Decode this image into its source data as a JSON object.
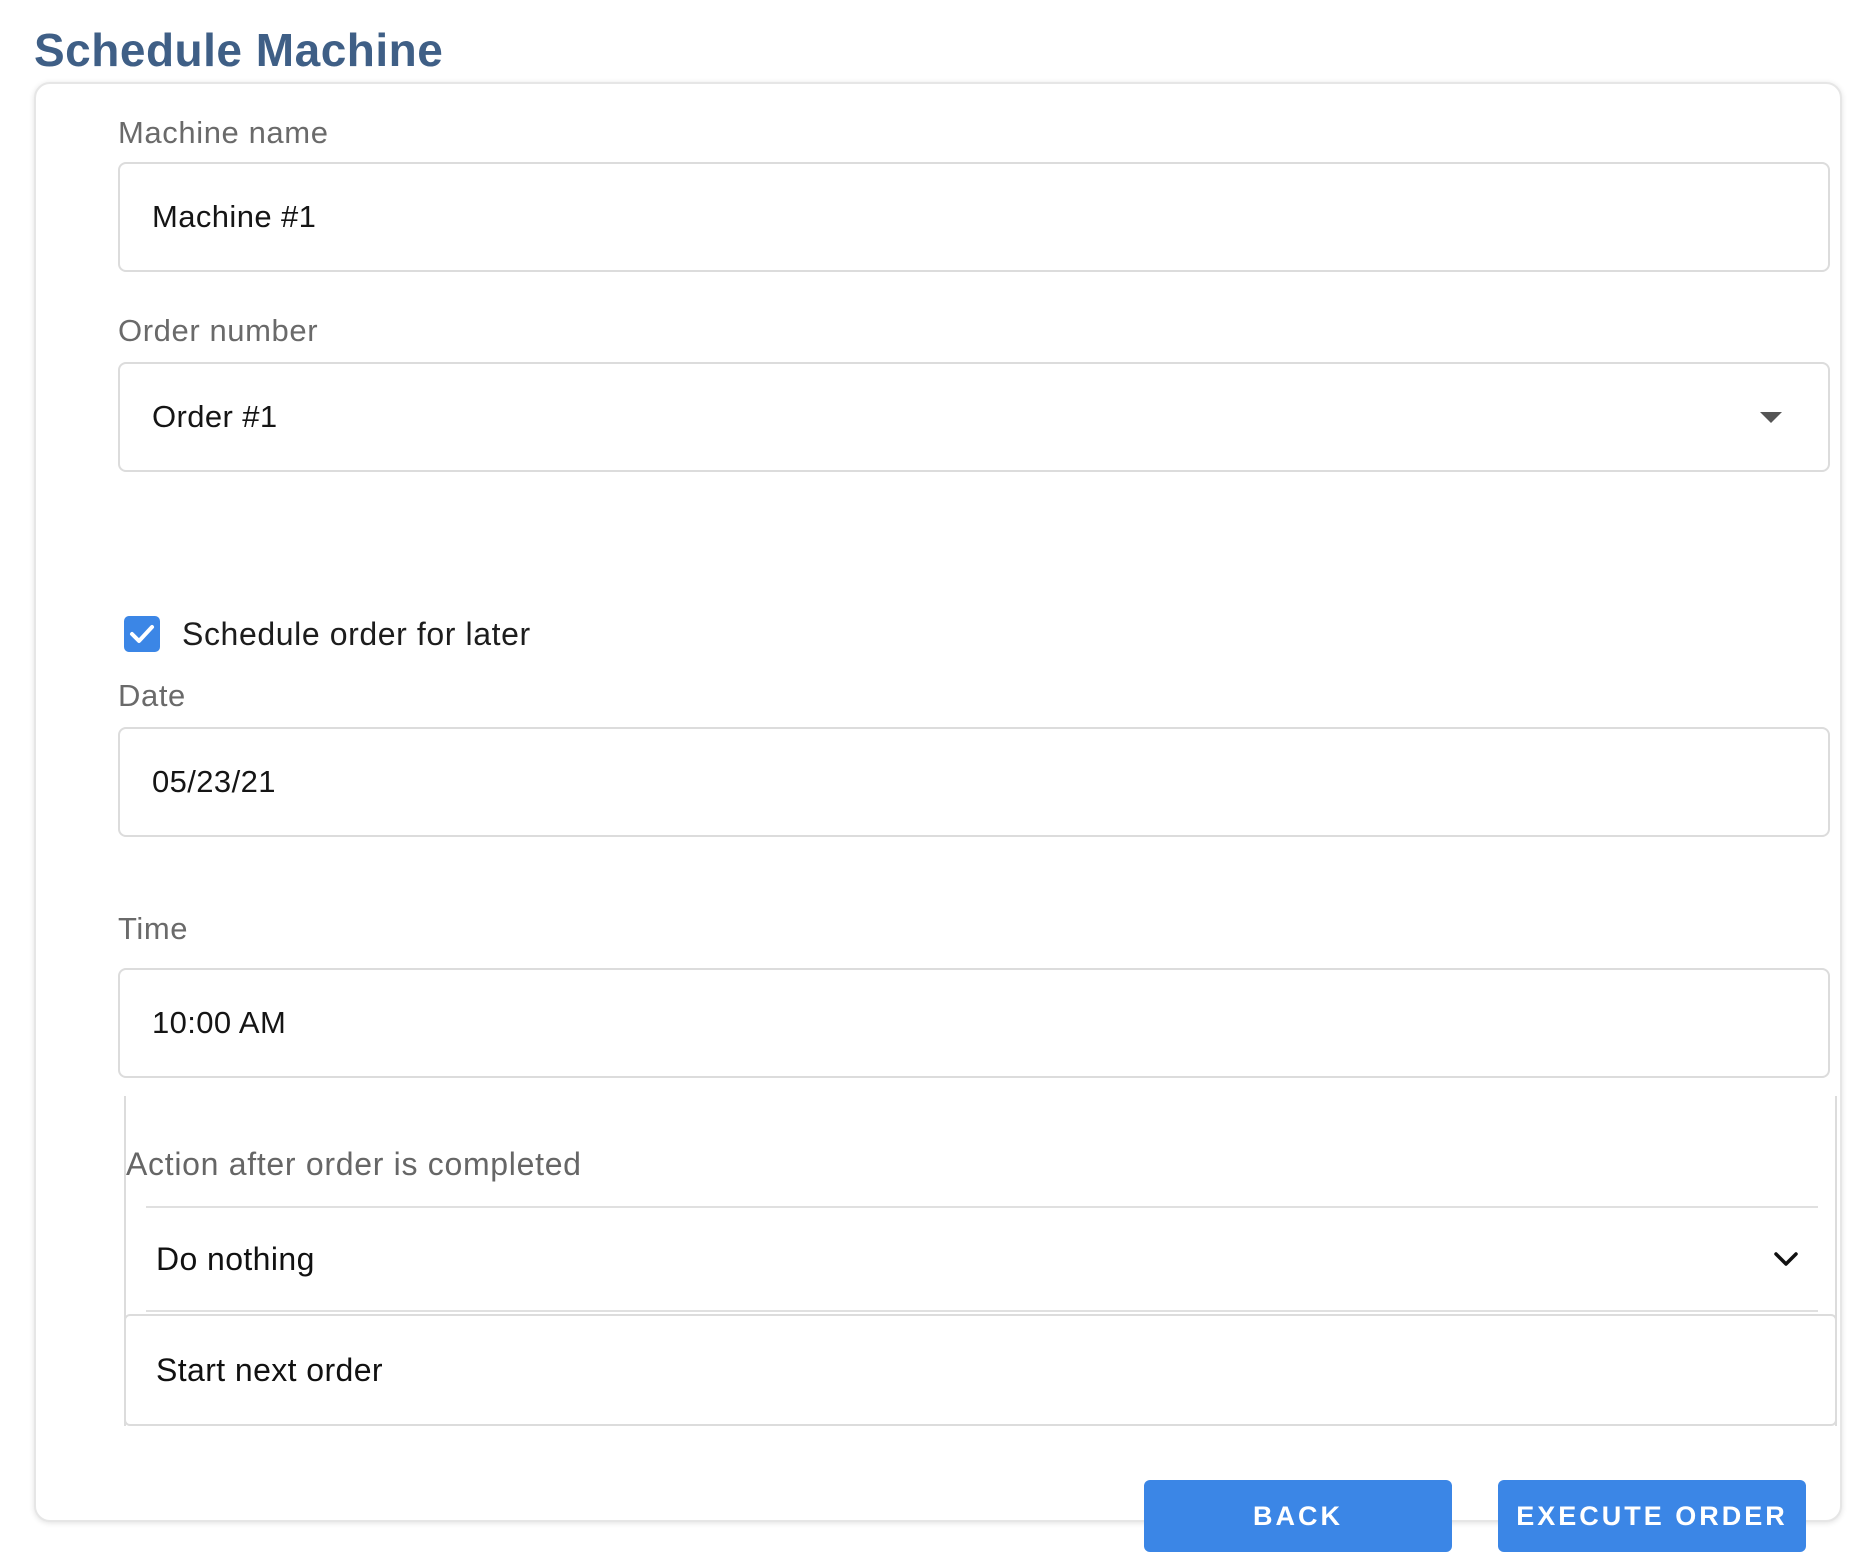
{
  "page": {
    "title": "Schedule Machine"
  },
  "form": {
    "machine_name": {
      "label": "Machine name",
      "value": "Machine #1"
    },
    "order_number": {
      "label": "Order number",
      "value": "Order #1",
      "icon": "caret-down-icon"
    },
    "schedule_later": {
      "label": "Schedule order for later",
      "checked": true,
      "color": "#3b86e6"
    },
    "date": {
      "label": "Date",
      "value": "05/23/21"
    },
    "time": {
      "label": "Time",
      "value": "10:00 AM"
    },
    "action_after": {
      "label": "Action after order is completed",
      "selected": "Do nothing",
      "icon": "chevron-down-icon",
      "options": [
        "Start next order"
      ]
    }
  },
  "buttons": {
    "back": "BACK",
    "execute": "EXECUTE ORDER",
    "color": "#3b86e6"
  }
}
